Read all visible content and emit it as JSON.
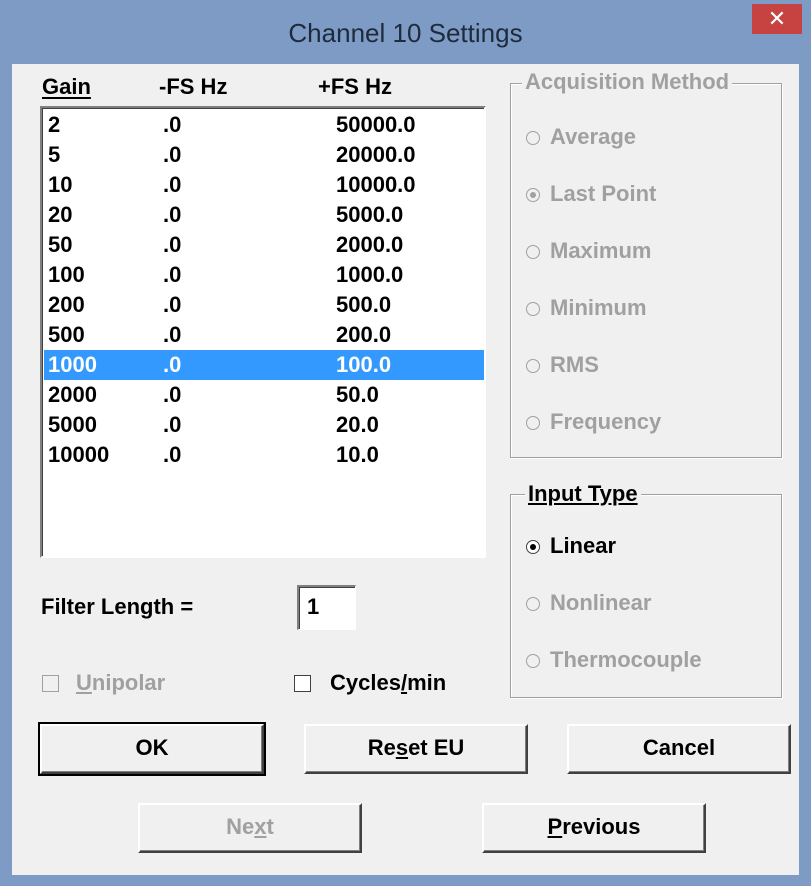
{
  "window": {
    "title": "Channel 10 Settings",
    "close_glyph": "✕"
  },
  "gain_list": {
    "headers": [
      "Gain",
      "-FS Hz",
      "+FS Hz"
    ],
    "rows": [
      [
        "2",
        ".0",
        "50000.0"
      ],
      [
        "5",
        ".0",
        "20000.0"
      ],
      [
        "10",
        ".0",
        "10000.0"
      ],
      [
        "20",
        ".0",
        "5000.0"
      ],
      [
        "50",
        ".0",
        "2000.0"
      ],
      [
        "100",
        ".0",
        "1000.0"
      ],
      [
        "200",
        ".0",
        "500.0"
      ],
      [
        "500",
        ".0",
        "200.0"
      ],
      [
        "1000",
        ".0",
        "100.0"
      ],
      [
        "2000",
        ".0",
        "50.0"
      ],
      [
        "5000",
        ".0",
        "20.0"
      ],
      [
        "10000",
        ".0",
        "10.0"
      ]
    ],
    "selected_index": 8
  },
  "filter": {
    "label": "Filter Length =",
    "value": "1"
  },
  "checkboxes": {
    "unipolar": {
      "label": "Unipolar",
      "checked": false,
      "enabled": false
    },
    "cycles_min": {
      "label": "Cycles/min",
      "checked": false,
      "enabled": true
    }
  },
  "acquisition_method": {
    "legend": "Acquisition Method",
    "enabled": false,
    "options": [
      "Average",
      "Last Point",
      "Maximum",
      "Minimum",
      "RMS",
      "Frequency"
    ],
    "selected": "Last Point"
  },
  "input_type": {
    "legend": "Input Type",
    "options": [
      {
        "label": "Linear",
        "enabled": true
      },
      {
        "label": "Nonlinear",
        "enabled": false
      },
      {
        "label": "Thermocouple",
        "enabled": false
      }
    ],
    "selected": "Linear"
  },
  "buttons": {
    "ok": "OK",
    "reset_eu": "Reset EU",
    "cancel": "Cancel",
    "next": "Next",
    "previous": "Previous"
  },
  "colors": {
    "titlebar": "#7e9bc5",
    "selection": "#3399ff",
    "close": "#c74342",
    "disabled_text": "#a0a0a0"
  }
}
